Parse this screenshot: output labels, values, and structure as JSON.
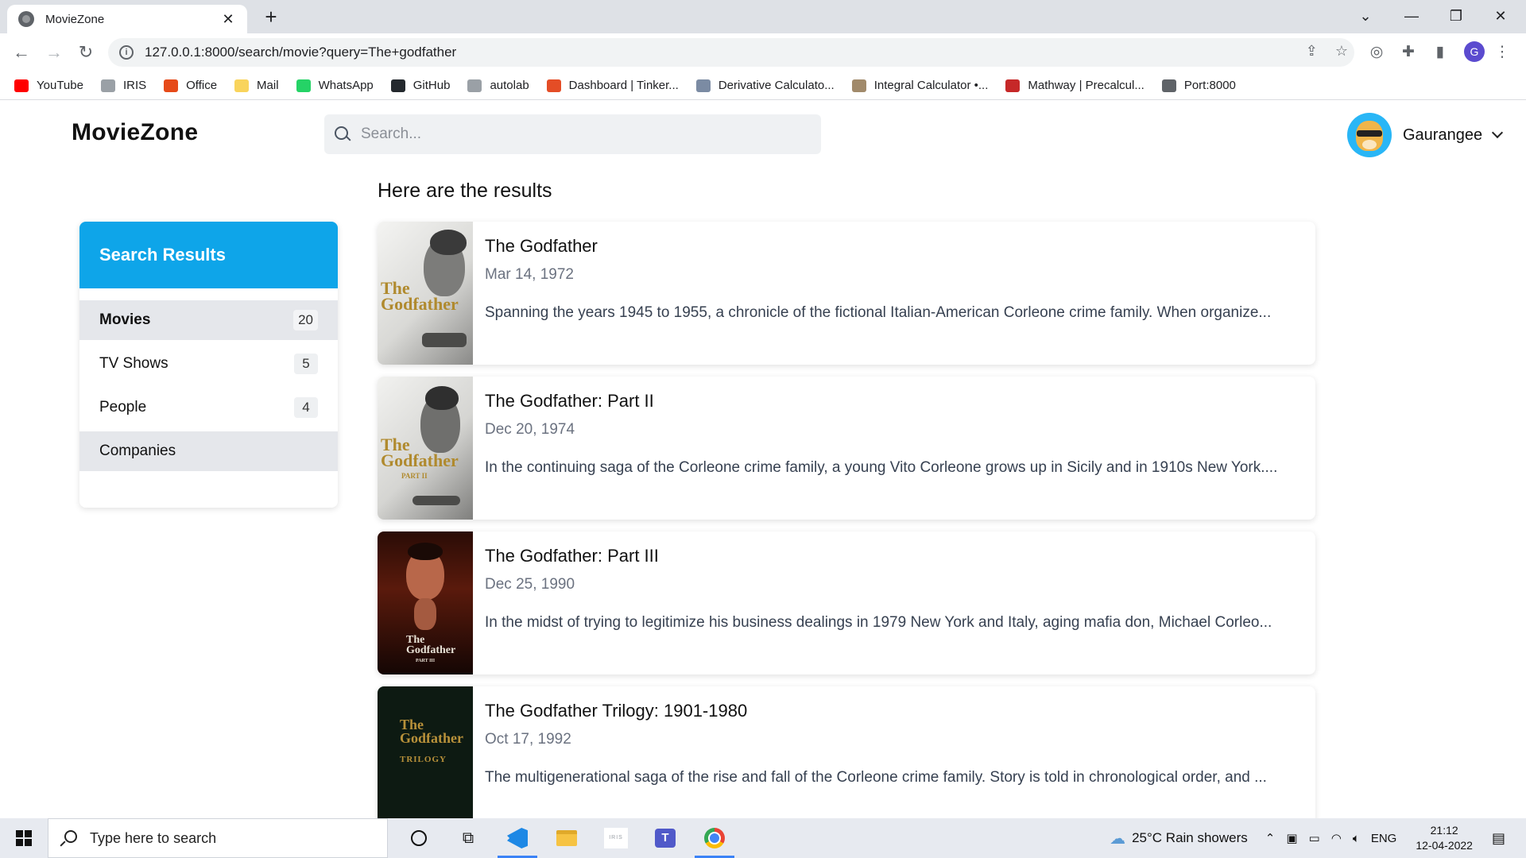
{
  "browser": {
    "tab_title": "MovieZone",
    "url": "127.0.0.1:8000/search/movie?query=The+godfather",
    "profile_initial": "G",
    "bookmarks": [
      {
        "label": "YouTube",
        "icon": "youtube-icon",
        "color": "#ff0000"
      },
      {
        "label": "IRIS",
        "icon": "iris-icon",
        "color": "#9aa0a6"
      },
      {
        "label": "Office",
        "icon": "office-icon",
        "color": "#e64a19"
      },
      {
        "label": "Mail",
        "icon": "folder-icon",
        "color": "#f9d45c"
      },
      {
        "label": "WhatsApp",
        "icon": "whatsapp-icon",
        "color": "#25d366"
      },
      {
        "label": "GitHub",
        "icon": "github-icon",
        "color": "#24292e"
      },
      {
        "label": "autolab",
        "icon": "autolab-icon",
        "color": "#9aa0a6"
      },
      {
        "label": "Dashboard | Tinker...",
        "icon": "tinkercad-icon",
        "color": "#e44d26"
      },
      {
        "label": "Derivative Calculato...",
        "icon": "derivative-icon",
        "color": "#7b8ba3"
      },
      {
        "label": "Integral Calculator •...",
        "icon": "integral-icon",
        "color": "#a18a6b"
      },
      {
        "label": "Mathway | Precalcul...",
        "icon": "mathway-icon",
        "color": "#c62828"
      },
      {
        "label": "Port:8000",
        "icon": "globe-icon",
        "color": "#5f6368"
      }
    ]
  },
  "app": {
    "logo": "MovieZone",
    "search_placeholder": "Search...",
    "user_name": "Gaurangee"
  },
  "sidebar": {
    "title": "Search Results",
    "items": [
      {
        "label": "Movies",
        "count": "20"
      },
      {
        "label": "TV Shows",
        "count": "5"
      },
      {
        "label": "People",
        "count": "4"
      },
      {
        "label": "Companies",
        "count": ""
      }
    ]
  },
  "results": {
    "heading": "Here are the results",
    "items": [
      {
        "title": "The Godfather",
        "date": "Mar 14, 1972",
        "overview": "Spanning the years 1945 to 1955, a chronicle of the fictional Italian-American Corleone crime family. When organize..."
      },
      {
        "title": "The Godfather: Part II",
        "date": "Dec 20, 1974",
        "overview": "In the continuing saga of the Corleone crime family, a young Vito Corleone grows up in Sicily and in 1910s New York...."
      },
      {
        "title": "The Godfather: Part III",
        "date": "Dec 25, 1990",
        "overview": "In the midst of trying to legitimize his business dealings in 1979 New York and Italy, aging mafia don, Michael Corleo..."
      },
      {
        "title": "The Godfather Trilogy: 1901-1980",
        "date": "Oct 17, 1992",
        "overview": "The multigenerational saga of the rise and fall of the Corleone crime family. Story is told in chronological order, and ..."
      }
    ],
    "posters": [
      {
        "text": "The Godfather",
        "sub": ""
      },
      {
        "text": "The Godfather",
        "sub": "PART II"
      },
      {
        "text": "The Godfather",
        "sub": "PART III"
      },
      {
        "text": "The Godfather",
        "sub": "TRILOGY"
      }
    ]
  },
  "taskbar": {
    "search_placeholder": "Type here to search",
    "weather": "25°C  Rain showers",
    "lang": "ENG",
    "time": "21:12",
    "date": "12-04-2022",
    "iris_label": "IRIS"
  }
}
